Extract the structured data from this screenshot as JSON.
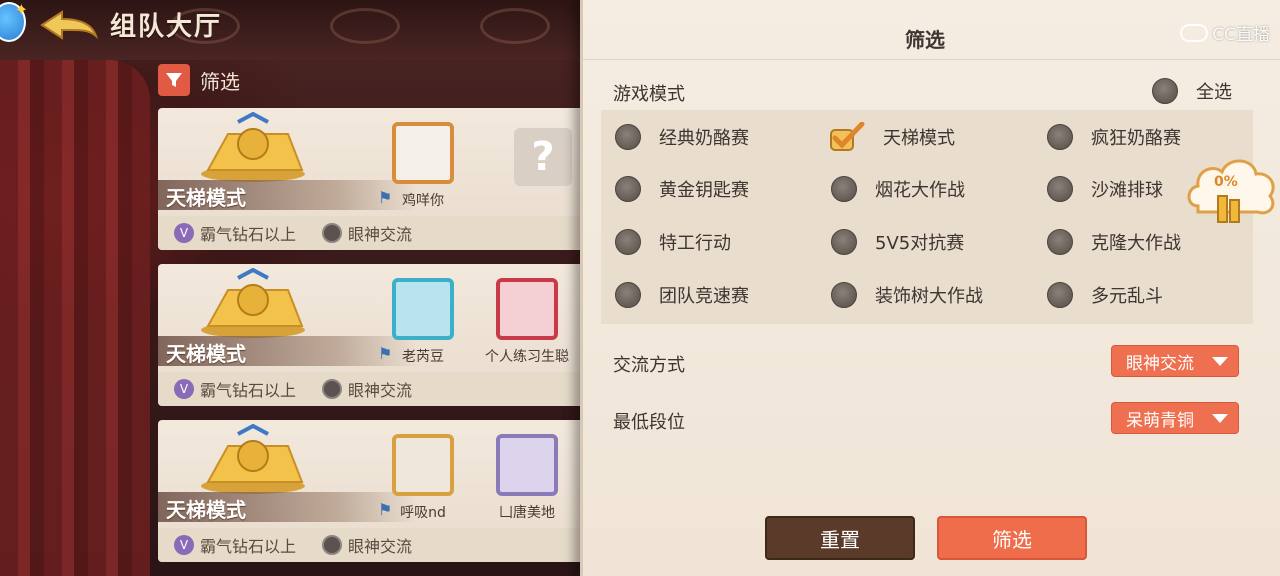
{
  "lobby": {
    "title": "组队大厅",
    "filter_label": "筛选"
  },
  "rooms": [
    {
      "mode": "天梯模式",
      "rank_req": "霸气钻石以上",
      "comm": "眼神交流",
      "players": [
        "鸡咩你"
      ],
      "empty_slot": "?"
    },
    {
      "mode": "天梯模式",
      "rank_req": "霸气钻石以上",
      "comm": "眼神交流",
      "players": [
        "老芮豆",
        "个人练习生聪"
      ]
    },
    {
      "mode": "天梯模式",
      "rank_req": "霸气钻石以上",
      "comm": "眼神交流",
      "players": [
        "呼吸nd",
        "凵唐美地"
      ]
    }
  ],
  "panel": {
    "title": "筛选",
    "watermark": "CC直播",
    "game_mode_label": "游戏模式",
    "select_all": "全选",
    "modes": [
      {
        "label": "经典奶酪赛",
        "checked": false
      },
      {
        "label": "天梯模式",
        "checked": true
      },
      {
        "label": "疯狂奶酪赛",
        "checked": false
      },
      {
        "label": "黄金钥匙赛",
        "checked": false
      },
      {
        "label": "烟花大作战",
        "checked": false
      },
      {
        "label": "沙滩排球",
        "checked": false
      },
      {
        "label": "特工行动",
        "checked": false
      },
      {
        "label": "5V5对抗赛",
        "checked": false
      },
      {
        "label": "克隆大作战",
        "checked": false
      },
      {
        "label": "团队竞速赛",
        "checked": false
      },
      {
        "label": "装饰树大作战",
        "checked": false
      },
      {
        "label": "多元乱斗",
        "checked": false
      }
    ],
    "comm_label": "交流方式",
    "comm_value": "眼神交流",
    "rank_label": "最低段位",
    "rank_value": "呆萌青铜",
    "reset_btn": "重置",
    "filter_btn": "筛选"
  },
  "bubble": {
    "percent": "0%"
  },
  "colors": {
    "accent": "#ef6d4a",
    "reset": "#5a3a28",
    "panel_bg": "#f5ede2"
  }
}
